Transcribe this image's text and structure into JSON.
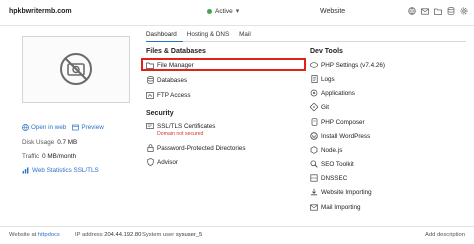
{
  "header": {
    "domain": "hpkbwritermb.com",
    "status": "Active",
    "website_label": "Website",
    "icons": [
      "globe-icon",
      "mail-icon",
      "folder-icon",
      "database-icon",
      "gear-icon"
    ]
  },
  "preview": {
    "icon": "no-image-icon",
    "open_in_web": "Open in web",
    "preview": "Preview",
    "disk_usage_label": "Disk Usage",
    "disk_usage_value": "0.7 MB",
    "traffic_label": "Traffic",
    "traffic_value": "0 MB/month",
    "web_statistics": "Web Statistics SSL/TLS"
  },
  "tabs": [
    "Dashboard",
    "Hosting & DNS",
    "Mail"
  ],
  "files_databases": {
    "title": "Files & Databases",
    "items": [
      "File Manager",
      "Databases",
      "FTP Access"
    ]
  },
  "security": {
    "title": "Security",
    "items": [
      "SSL/TLS Certificates",
      "Password-Protected Directories",
      "Advisor"
    ],
    "ssl_warning": "Domain not secured"
  },
  "dev_tools": {
    "title": "Dev Tools",
    "items": [
      "PHP Settings (v7.4.26)",
      "Logs",
      "Applications",
      "Git",
      "PHP Composer",
      "Install WordPress",
      "Node.js",
      "SEO Toolkit",
      "DNSSEC",
      "Website Importing",
      "Mail Importing"
    ]
  },
  "footer": {
    "website_at_label": "Website at",
    "website_at_value": "httpdocs",
    "ip_label": "IP address",
    "ip_value": "204.44.192.80",
    "system_user_label": "System user",
    "system_user_value": "sysuser_5",
    "add_description": "Add description"
  },
  "colors": {
    "accent": "#2a72c7",
    "highlight": "#e0221b",
    "active": "#47a34d",
    "warning": "#d9342b"
  }
}
